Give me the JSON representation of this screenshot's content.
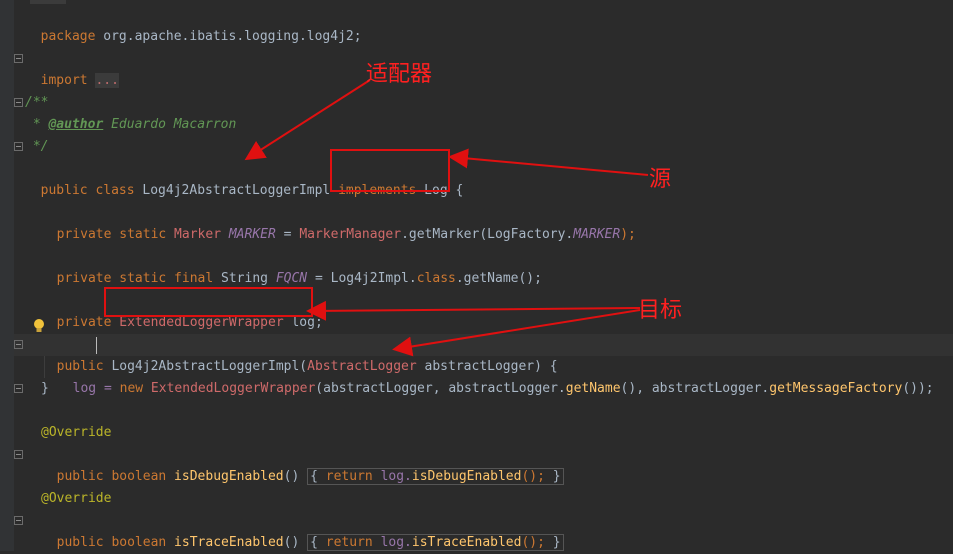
{
  "code": {
    "package_kw": "package",
    "package_name": " org.apache.ibatis.logging.log4j2;",
    "import_kw": "import",
    "import_fold": "...",
    "doc_open": "/**",
    "doc_star": " * ",
    "doc_tag": "@author",
    "doc_author": " Eduardo Macarron",
    "doc_close": " */",
    "class_mods": "public class",
    "class_name": " Log4j2AbstractLoggerImpl ",
    "implements_kw": "implements",
    "class_iface": " Log {",
    "f1_mods": "private static",
    "f1_type": " Marker",
    "f1_name": " MARKER",
    "f1_assign": " = ",
    "f1_value": "MarkerManager",
    "f1_rest_a": ".getMarker(LogFactory.",
    "f1_rest_b": "MARKER",
    "f1_rest_c": ");",
    "f2_mods": "private static final",
    "f2_type": " String",
    "f2_name": " FQCN",
    "f2_assign": " = Log4j2Impl.",
    "f2_class": "class",
    "f2_rest": ".getName();",
    "f3_mods": "private",
    "f3_type": "ExtendedLoggerWrapper",
    "f3_name": " log;",
    "ctor_mods": "public",
    "ctor_name": "Log4j2AbstractLoggerImpl",
    "ctor_open": "(",
    "ctor_ptype": "AbstractLogger",
    "ctor_pname": " abstractLogger) {",
    "body_lhs": "log = ",
    "body_new": "new",
    "body_type": " ExtendedLoggerWrapper",
    "body_a": "(abstractLogger, abstractLogger.",
    "body_m1": "getName",
    "body_b": "(), abstractLogger.",
    "body_m2": "getMessageFactory",
    "body_c": "());",
    "close_brace": "}",
    "override1": "@Override",
    "m1_mods": "public boolean",
    "m1_name": " isDebugEnabled",
    "m1_sig": "() ",
    "m1_body_open": "{ ",
    "m1_return": "return",
    "m1_expr": " log.",
    "m1_call": "isDebugEnabled",
    "m1_end": "(); ",
    "m1_body_close": "}",
    "override2": "@Override",
    "m2_mods": "public boolean",
    "m2_name": " isTraceEnabled",
    "m2_sig": "() ",
    "m2_body_open": "{ ",
    "m2_return": "return",
    "m2_expr": " log.",
    "m2_call": "isTraceEnabled",
    "m2_end": "(); ",
    "m2_body_close": "}"
  },
  "annotations": {
    "adapter": "适配器",
    "source": "源",
    "target": "目标"
  },
  "colors": {
    "background": "#2b2b2b",
    "keyword": "#cc7832",
    "comment": "#629755",
    "field": "#9876aa",
    "annotation_arrow": "#e01010"
  }
}
